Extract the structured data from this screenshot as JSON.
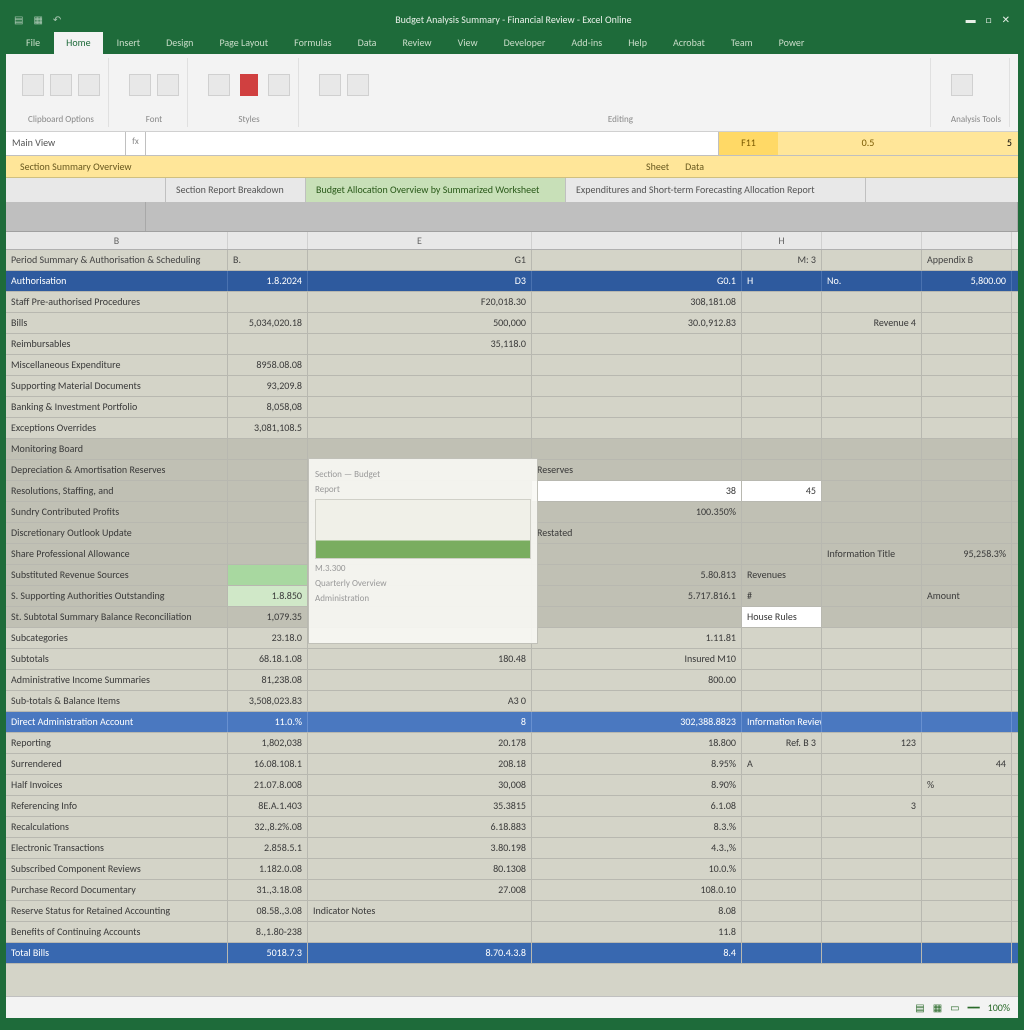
{
  "titlebar": {
    "qat": [
      "▤",
      "▦",
      "↶"
    ],
    "title": "Budget Analysis Summary - Financial Review - Excel Online",
    "winbtns": [
      "▬",
      "□",
      "✕"
    ]
  },
  "ribbon_tabs": [
    "File",
    "Home",
    "Insert",
    "Design",
    "Page Layout",
    "Formulas",
    "Data",
    "Review",
    "View",
    "Developer",
    "Add-ins",
    "Help",
    "Acrobat",
    "Team",
    "Power"
  ],
  "ribbon_groups": [
    {
      "label": "Clipboard Options"
    },
    {
      "label": "Font"
    },
    {
      "label": "Styles"
    },
    {
      "label": "Editing"
    },
    {
      "label": "Analysis Tools"
    }
  ],
  "formula": {
    "namebox": "Main View",
    "fx": "fx",
    "value": "",
    "c1": "F11",
    "c2": "0.5",
    "c3": "5"
  },
  "tabstrip2": {
    "left": "Section Summary Overview",
    "mid1": "Sheet",
    "mid2": "Data"
  },
  "tabstrip3": {
    "tabs": [
      {
        "label": "Section Report Breakdown",
        "active": false
      },
      {
        "label": "Budget Allocation Overview by Summarized Worksheet",
        "active": true
      },
      {
        "label": "Expenditures and Short-term Forecasting Allocation Report",
        "active": false
      }
    ]
  },
  "colheads": [
    "B",
    "",
    "E",
    "",
    "H",
    "",
    ""
  ],
  "rows": [
    {
      "cls": "title",
      "cells": [
        "Period Summary & Authorisation & Scheduling",
        "B.",
        "G1",
        "",
        "M: 3",
        "",
        "Appendix B"
      ]
    },
    {
      "cls": "header",
      "cells": [
        "Authorisation",
        "1.8.2024",
        "D3",
        "G0.1",
        "H",
        "No.",
        "5,800.00"
      ]
    },
    {
      "cls": "",
      "cells": [
        "Staff Pre-authorised Procedures",
        "",
        "F20,018.30",
        "308,181.08",
        "",
        "",
        ""
      ]
    },
    {
      "cls": "",
      "cells": [
        "Bills",
        "5,034,020.18",
        "500,000",
        "30.0,912.83",
        "",
        "Revenue 4",
        ""
      ]
    },
    {
      "cls": "",
      "cells": [
        "Reimbursables",
        "",
        "35,118.0",
        "",
        "",
        "",
        ""
      ]
    },
    {
      "cls": "",
      "cells": [
        "Miscellaneous Expenditure",
        "8958.08.08",
        "",
        "",
        "",
        "",
        ""
      ]
    },
    {
      "cls": "",
      "cells": [
        "Supporting Material Documents",
        "93,209.8",
        "",
        "",
        "",
        "",
        ""
      ]
    },
    {
      "cls": "",
      "cells": [
        "Banking & Investment Portfolio",
        "8,058,08",
        "",
        "",
        "",
        "",
        ""
      ]
    },
    {
      "cls": "",
      "cells": [
        "Exceptions Overrides",
        "3,081,108.5",
        "",
        "",
        "",
        "",
        ""
      ]
    },
    {
      "cls": "sub",
      "cells": [
        "Monitoring Board",
        "",
        "",
        "",
        "",
        "",
        ""
      ]
    },
    {
      "cls": "sub",
      "cells": [
        "Depreciation & Amortisation Reserves",
        "",
        "",
        "Reserves",
        "",
        "",
        ""
      ]
    },
    {
      "cls": "sub",
      "cells": [
        "Resolutions, Staffing, and",
        "",
        "",
        "38",
        "45",
        "",
        ""
      ]
    },
    {
      "cls": "sub",
      "cells": [
        "Sundry Contributed Profits",
        "",
        "",
        "100.350%",
        "",
        "",
        ""
      ]
    },
    {
      "cls": "sub",
      "cells": [
        "Discretionary Outlook Update",
        "",
        "",
        "Restated",
        "",
        "",
        ""
      ]
    },
    {
      "cls": "sub",
      "cells": [
        "Share Professional Allowance",
        "",
        "",
        "",
        "",
        "Information Title",
        "95,258.3%"
      ]
    },
    {
      "cls": "sub",
      "cells": [
        "Substituted Revenue Sources",
        "",
        "",
        "5.80.813",
        "Revenues",
        "",
        ""
      ]
    },
    {
      "cls": "sub",
      "cells": [
        "S. Supporting Authorities Outstanding",
        "1.8.850",
        "",
        "5.717.816.1",
        "#",
        "",
        "Amount"
      ]
    },
    {
      "cls": "sub",
      "cells": [
        "St. Subtotal Summary Balance Reconciliation",
        "1,079.35",
        "",
        "",
        "House Rules",
        "",
        ""
      ]
    },
    {
      "cls": "",
      "cells": [
        "Subcategories",
        "23.18.0",
        "",
        "1.11.81",
        "",
        "",
        ""
      ]
    },
    {
      "cls": "",
      "cells": [
        "Subtotals",
        "68.18.1.08",
        "180.48",
        "Insured M10",
        "",
        "",
        ""
      ]
    },
    {
      "cls": "",
      "cells": [
        "Administrative Income Summaries",
        "81,238.08",
        "",
        "800.00",
        "",
        "",
        ""
      ]
    },
    {
      "cls": "",
      "cells": [
        "Sub-totals & Balance Items",
        "3,508,023.83",
        "A3  0",
        "",
        "",
        "",
        ""
      ]
    },
    {
      "cls": "blue2",
      "cells": [
        "Direct Administration Account",
        "11.0.%",
        "8",
        "302,388.8823",
        "Information Review Notes",
        "",
        ""
      ]
    },
    {
      "cls": "",
      "cells": [
        "Reporting",
        "1,802,038",
        "20.178",
        "18.800",
        "Ref. B 3",
        "123",
        ""
      ]
    },
    {
      "cls": "",
      "cells": [
        "Surrendered",
        "16.08.108.1",
        "208.18",
        "8.95%",
        "A",
        "",
        "44"
      ]
    },
    {
      "cls": "",
      "cells": [
        "Half Invoices",
        "21.07.8.008",
        "30,008",
        "8.90%",
        "",
        "",
        "%"
      ]
    },
    {
      "cls": "",
      "cells": [
        "Referencing Info",
        "8E.A.1.403",
        "35.3815",
        "6.1.08",
        "",
        "3",
        ""
      ]
    },
    {
      "cls": "",
      "cells": [
        "Recalculations",
        "32.,8.2%.08",
        "6.18.883",
        "8.3.%",
        "",
        "",
        ""
      ]
    },
    {
      "cls": "",
      "cells": [
        "Electronic Transactions",
        "2.858.5.1",
        "3.80.198",
        "4.3.,%",
        "",
        "",
        ""
      ]
    },
    {
      "cls": "",
      "cells": [
        "Subscribed Component Reviews",
        "1.182.0.08",
        "80.1308",
        "10.0.%",
        "",
        "",
        ""
      ]
    },
    {
      "cls": "",
      "cells": [
        "Purchase Record Documentary",
        "31.,3.18.08",
        "27.008",
        "108.0.10",
        "",
        "",
        ""
      ]
    },
    {
      "cls": "",
      "cells": [
        "Reserve Status for Retained Accounting",
        "08.58.,3.08",
        "Indicator Notes",
        "8.08",
        "",
        "",
        ""
      ]
    },
    {
      "cls": "",
      "cells": [
        "Benefits of Continuing Accounts",
        "8.,1.80-238",
        "",
        "11.8",
        "",
        "",
        ""
      ]
    },
    {
      "cls": "total",
      "cells": [
        "  Total Bills",
        "5018.7.3",
        "8.70.4.3.8",
        "8.4",
        "",
        "",
        ""
      ]
    }
  ],
  "float": {
    "t1": "Section — Budget",
    "t2": "Report",
    "t3": "M.3.300",
    "t4": "Quarterly Overview",
    "t5": "Administration"
  },
  "statusbar": {
    "left": "",
    "zoom": "100%",
    "icons": [
      "▤",
      "▦",
      "▭",
      "━━"
    ]
  }
}
